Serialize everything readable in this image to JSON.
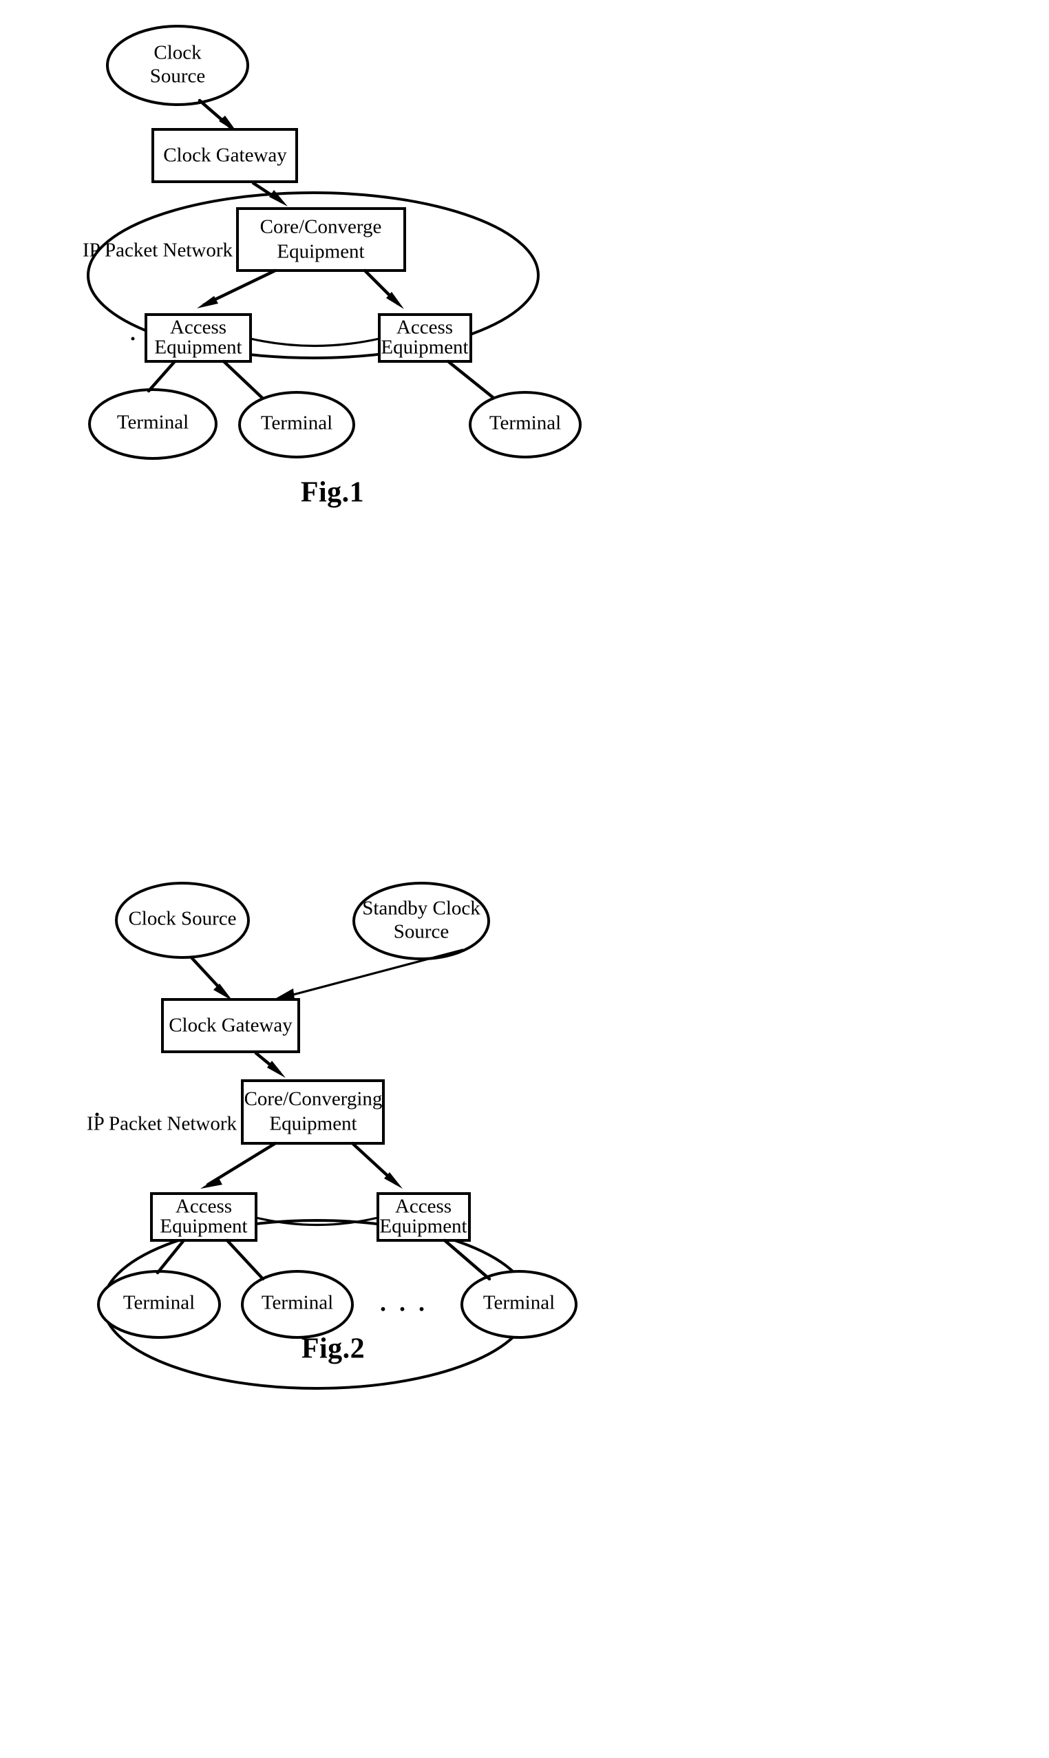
{
  "document": {
    "kind": "patent-drawing-sheet",
    "background_color": "#ffffff",
    "ink_color": "#000000"
  },
  "figures": [
    {
      "id": "fig1",
      "caption": "Fig.1",
      "network_label": "IP Packet Network",
      "nodes": {
        "clock_source": "Clock\nSource",
        "clock_source_line1": "Clock",
        "clock_source_line2": "Source",
        "clock_gateway": "Clock Gateway",
        "core_equipment_line1": "Core/Converge",
        "core_equipment_line2": "Equipment",
        "access_left_line1": "Access",
        "access_left_line2": "Equipment",
        "access_right_line1": "Access",
        "access_right_line2": "Equipment",
        "terminal_1": "Terminal",
        "terminal_2": "Terminal",
        "terminal_3": "Terminal"
      }
    },
    {
      "id": "fig2",
      "caption": "Fig.2",
      "network_label": "IP Packet Network",
      "ellipsis": ". . .",
      "nodes": {
        "clock_source": "Clock Source",
        "standby_clock_source_line1": "Standby Clock",
        "standby_clock_source_line2": "Source",
        "clock_gateway": "Clock Gateway",
        "core_equipment_line1": "Core/Converging",
        "core_equipment_line2": "Equipment",
        "access_left_line1": "Access",
        "access_left_line2": "Equipment",
        "access_right_line1": "Access",
        "access_right_line2": "Equipment",
        "terminal_1": "Terminal",
        "terminal_2": "Terminal",
        "terminal_3": "Terminal"
      }
    }
  ]
}
